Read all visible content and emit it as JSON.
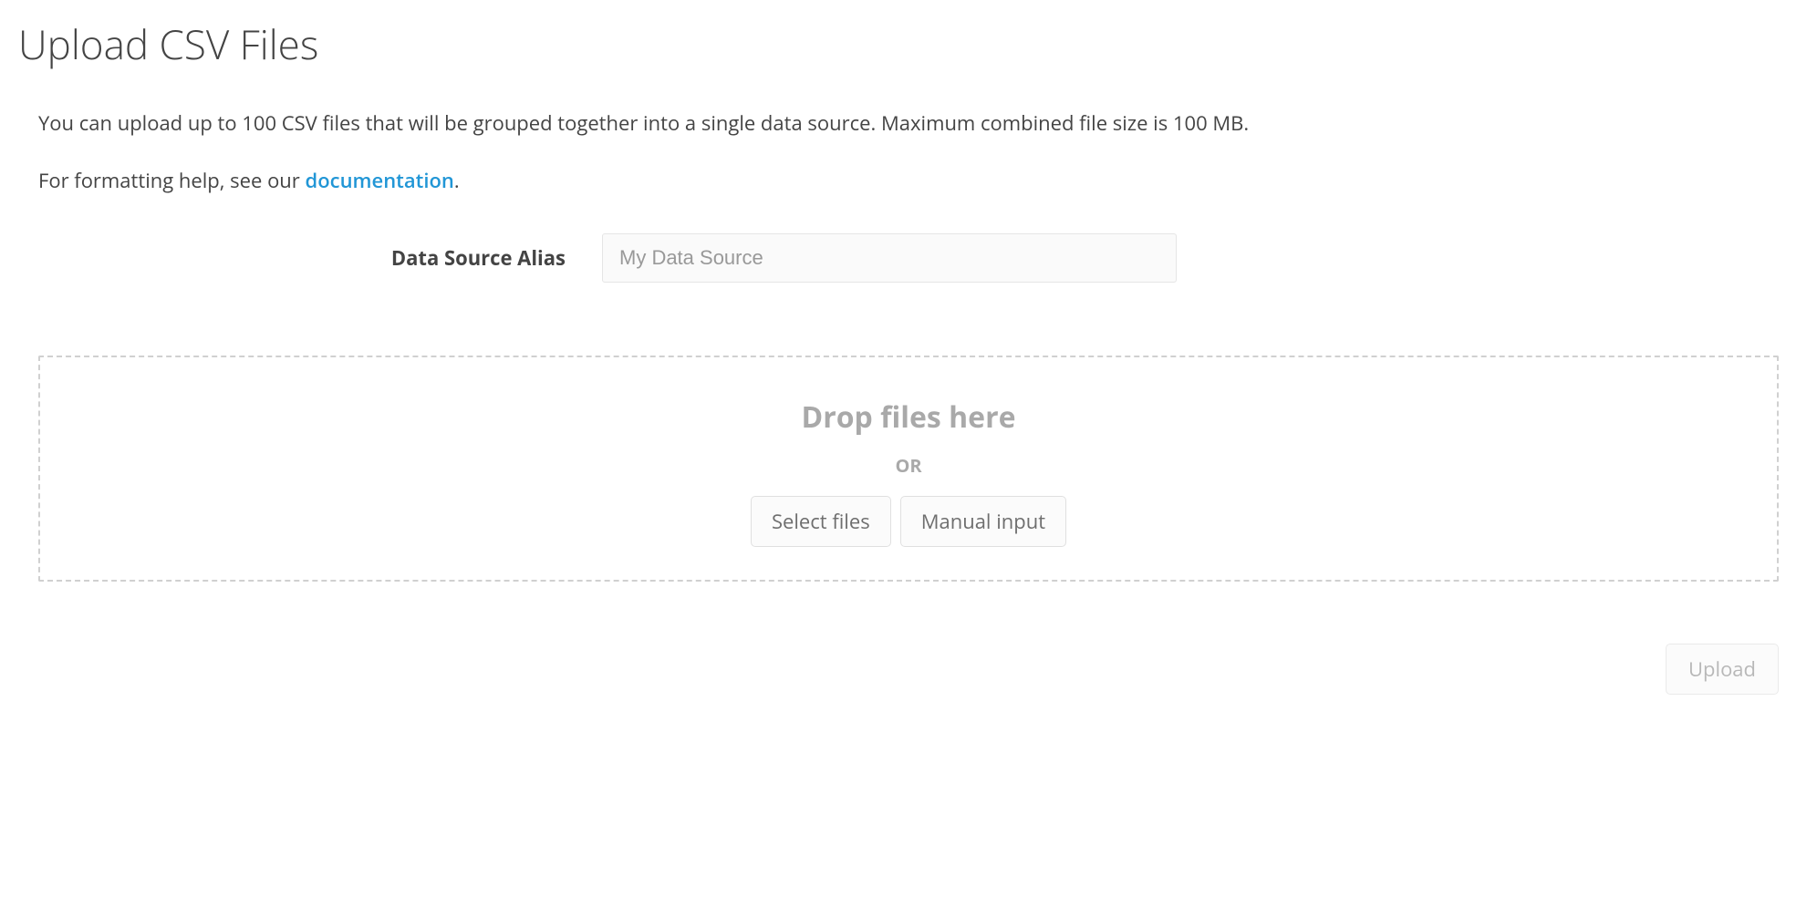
{
  "title": "Upload CSV Files",
  "intro": {
    "line1": "You can upload up to 100 CSV files that will be grouped together into a single data source. Maximum combined file size is 100 MB.",
    "line2_prefix": "For formatting help, see our ",
    "line2_link": "documentation",
    "line2_suffix": "."
  },
  "form": {
    "alias_label": "Data Source Alias",
    "alias_placeholder": "My Data Source",
    "alias_value": ""
  },
  "dropzone": {
    "title": "Drop files here",
    "or": "OR",
    "select_files": "Select files",
    "manual_input": "Manual input"
  },
  "footer": {
    "upload": "Upload"
  }
}
